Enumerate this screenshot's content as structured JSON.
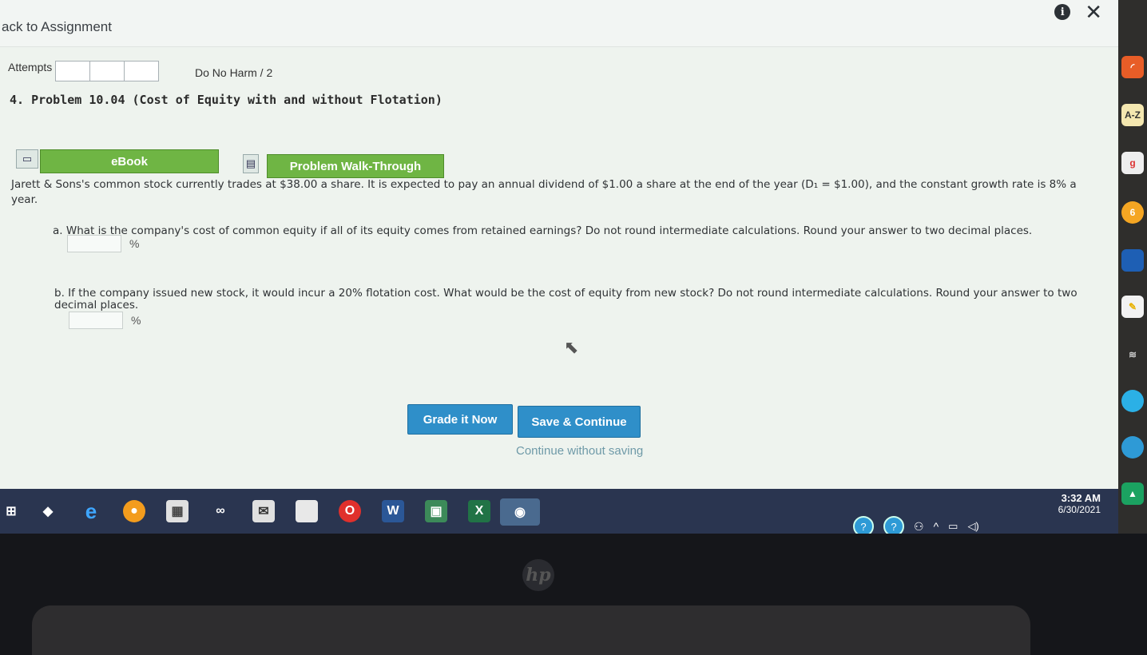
{
  "header": {
    "back_link": "ack to Assignment"
  },
  "attempts": {
    "label": "Attempts",
    "box_count": 3
  },
  "score": "Do No Harm / 2",
  "problem": {
    "title": "4.  Problem 10.04 (Cost of Equity with and without Flotation)",
    "ebook_label": "eBook",
    "walkthrough_label": "Problem Walk-Through",
    "stem": "Jarett & Sons's common stock currently trades at $38.00 a share. It is expected to pay an annual dividend of $1.00 a share at the end of the year (D₁ = $1.00), and the constant growth rate is 8% a year.",
    "part_a": {
      "question": "a. What is the company's cost of common equity if all of its equity comes from retained earnings? Do not round intermediate calculations. Round your answer to two decimal places.",
      "unit": "%",
      "value": ""
    },
    "part_b": {
      "question": "b. If the company issued new stock, it would incur a 20% flotation cost. What would be the cost of equity from new stock? Do not round intermediate calculations. Round your answer to two decimal places.",
      "unit": "%",
      "value": ""
    }
  },
  "actions": {
    "grade": "Grade it Now",
    "save": "Save & Continue",
    "continue": "Continue without saving"
  },
  "taskbar": {
    "time": "3:32 AM",
    "date": "6/30/2021"
  },
  "dock": {
    "az_label": "A-Z"
  },
  "colors": {
    "green_button": "#6fb544",
    "blue_button": "#2f8fc9",
    "taskbar": "#2a3550"
  }
}
